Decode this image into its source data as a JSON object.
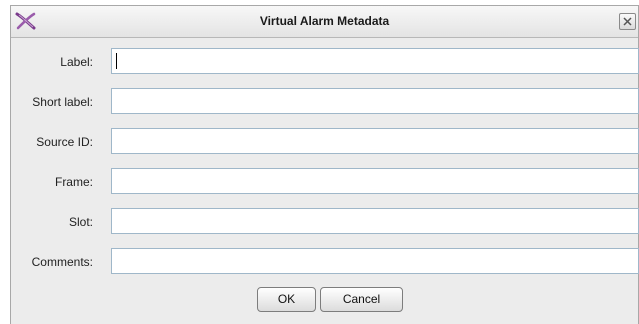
{
  "dialog": {
    "title": "Virtual Alarm Metadata",
    "app_icon": "x-logo-icon",
    "close_icon": "close-icon"
  },
  "fields": [
    {
      "label": "Label:",
      "value": "",
      "focused": true
    },
    {
      "label": "Short label:",
      "value": ""
    },
    {
      "label": "Source ID:",
      "value": ""
    },
    {
      "label": "Frame:",
      "value": ""
    },
    {
      "label": "Slot:",
      "value": ""
    },
    {
      "label": "Comments:",
      "value": ""
    }
  ],
  "buttons": {
    "ok_label": "OK",
    "cancel_label": "Cancel"
  },
  "colors": {
    "dialog_bg": "#ececec",
    "field_border": "#9fb7c9",
    "app_icon_accent": "#7a3b8c"
  }
}
